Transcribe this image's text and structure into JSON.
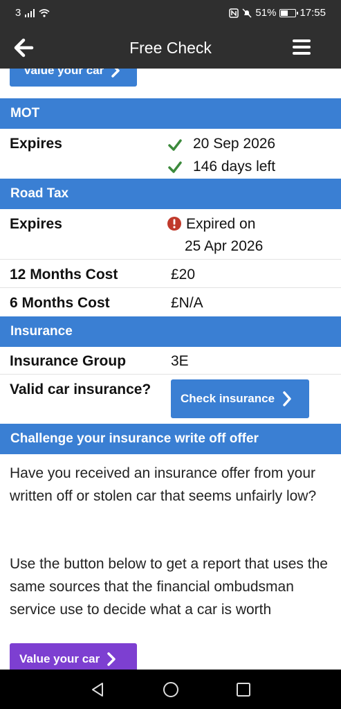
{
  "status_bar": {
    "sim": "3",
    "battery_text": "51%",
    "battery_level": 0.51,
    "time": "17:55"
  },
  "header": {
    "title": "Free Check"
  },
  "buttons": {
    "value_car_top": "Value your car",
    "check_insurance": "Check insurance",
    "value_car_bottom": "Value your car"
  },
  "mot": {
    "title": "MOT",
    "expires_label": "Expires",
    "expiry_date": "20 Sep 2026",
    "days_left": "146 days left"
  },
  "road_tax": {
    "title": "Road Tax",
    "expires_label": "Expires",
    "status_line1": "Expired on",
    "status_line2": "25 Apr 2026",
    "cost_12_label": "12 Months Cost",
    "cost_12_value": "£20",
    "cost_6_label": "6 Months Cost",
    "cost_6_value": "£N/A"
  },
  "insurance": {
    "title": "Insurance",
    "group_label": "Insurance Group",
    "group_value": "3E",
    "valid_label": "Valid car insurance?"
  },
  "challenge": {
    "title": "Challenge your insurance write off offer",
    "paragraph1": "Have you received an insurance offer from your written off or stolen car that seems unfairly low?",
    "paragraph2": "Use the button below to get a report that uses the same sources that the financial ombudsman service use to decide what a car is worth"
  },
  "colors": {
    "header_bg": "#2f2f2f",
    "section_blue": "#3a7fd3",
    "button_purple": "#7d3fd1",
    "check_green": "#3c8a3c",
    "alert_red": "#c0392b"
  },
  "icons": [
    "back-arrow-icon",
    "menu-icon",
    "check-icon",
    "alert-icon",
    "chevron-right-icon",
    "nav-back-icon",
    "nav-home-icon",
    "nav-recents-icon"
  ]
}
